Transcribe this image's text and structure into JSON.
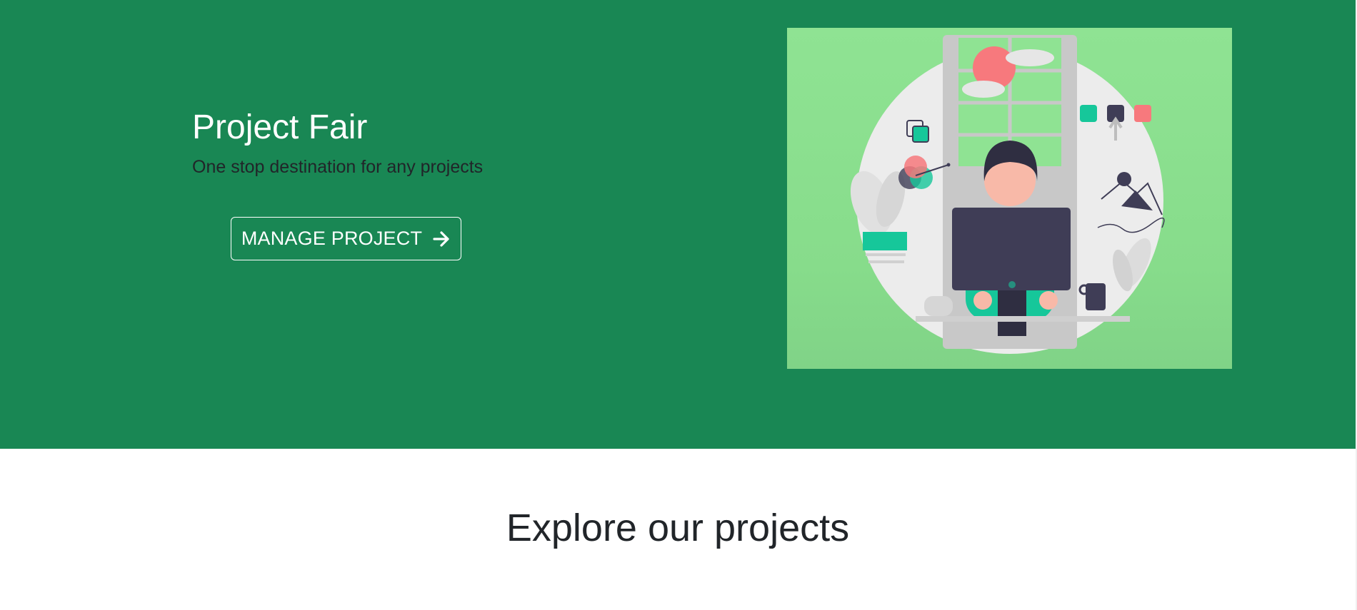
{
  "hero": {
    "title": "Project Fair",
    "subtitle": "One stop destination for any projects",
    "button_label": "MANAGE PROJECT",
    "button_icon": "arrow-right-icon",
    "background_color": "#198754",
    "illustration": "person-working-at-computer-illustration"
  },
  "explore": {
    "title": "Explore our projects"
  },
  "colors": {
    "hero_green": "#198754",
    "illustration_bg": "#8fe393",
    "accent_teal": "#16c79a",
    "accent_pink": "#f7797d",
    "dark": "#3f3d56"
  }
}
